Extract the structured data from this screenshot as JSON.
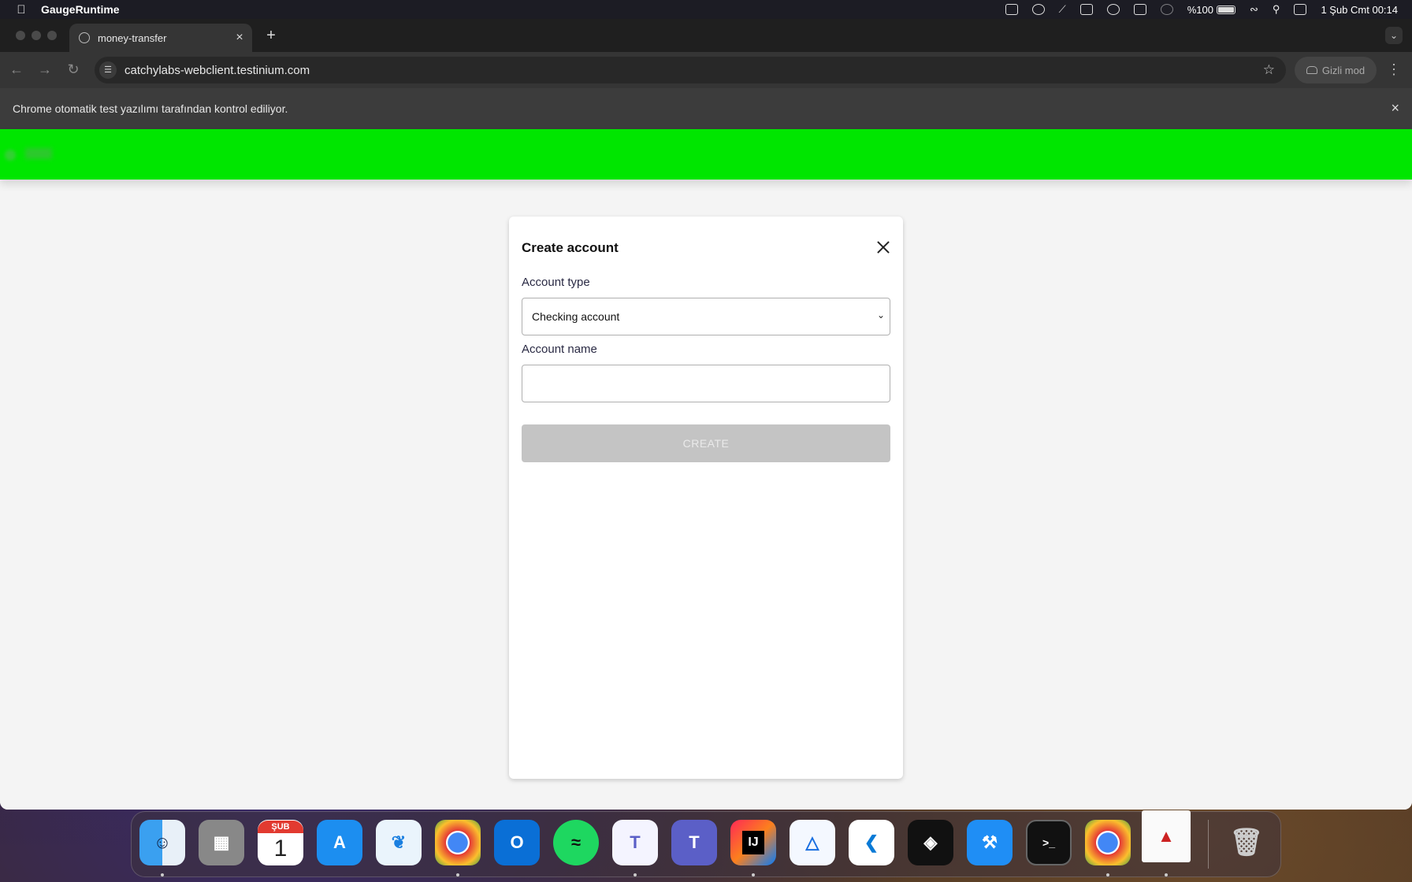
{
  "menubar": {
    "app_name": "GaugeRuntime",
    "battery": "%100",
    "datetime": "1 Şub Cmt  00:14"
  },
  "browser": {
    "tab_title": "money-transfer",
    "new_tab": "+",
    "url": "catchylabs-webclient.testinium.com",
    "incognito_label": "Gizli mod",
    "automation_notice": "Chrome otomatik test yazılımı tarafından kontrol ediliyor."
  },
  "modal": {
    "title": "Create account",
    "account_type_label": "Account type",
    "account_type_value": "Checking account",
    "account_name_label": "Account name",
    "account_name_value": "",
    "create_button": "CREATE"
  },
  "colors": {
    "header_green": "#00e600",
    "button_disabled": "#c4c4c4"
  },
  "dock": {
    "calendar_month": "ŞUB",
    "calendar_day": "1",
    "items": [
      "finder-icon",
      "launchpad-icon",
      "calendar-icon",
      "app-store-icon",
      "safari-icon",
      "chrome-icon",
      "outlook-icon",
      "spotify-icon",
      "teams-classic-icon",
      "teams-icon",
      "intellij-icon",
      "instruments-icon",
      "vscode-icon",
      "unity-icon",
      "xcode-icon",
      "terminal-icon",
      "chrome-icon",
      "java-icon",
      "trash-icon"
    ]
  }
}
